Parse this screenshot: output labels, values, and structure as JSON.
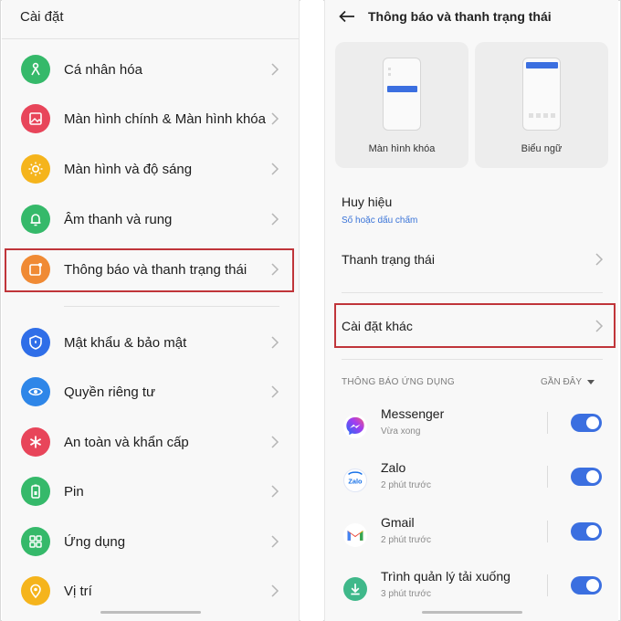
{
  "left": {
    "title": "Cài đặt",
    "items": [
      {
        "label": "Cá nhân hóa",
        "icon": "personalization-icon",
        "color": "#35b96a"
      },
      {
        "label": "Màn hình chính & Màn hình khóa",
        "icon": "wallpaper-icon",
        "color": "#e8455a"
      },
      {
        "label": "Màn hình và độ sáng",
        "icon": "brightness-icon",
        "color": "#f5b41c"
      },
      {
        "label": "Âm thanh và rung",
        "icon": "bell-icon",
        "color": "#35b96a"
      },
      {
        "label": "Thông báo và thanh trạng thái",
        "icon": "notification-icon",
        "color": "#f08a34"
      },
      {
        "label": "Mật khẩu & bảo mật",
        "icon": "shield-icon",
        "color": "#2f6ee8"
      },
      {
        "label": "Quyền riêng tư",
        "icon": "eye-icon",
        "color": "#2e86e8"
      },
      {
        "label": "An toàn và khẩn cấp",
        "icon": "emergency-icon",
        "color": "#e8455a"
      },
      {
        "label": "Pin",
        "icon": "battery-icon",
        "color": "#35b96a"
      },
      {
        "label": "Ứng dụng",
        "icon": "apps-icon",
        "color": "#35b96a"
      },
      {
        "label": "Vị trí",
        "icon": "location-icon",
        "color": "#f5b41c"
      }
    ]
  },
  "right": {
    "title": "Thông báo và thanh trạng thái",
    "cards": [
      {
        "label": "Màn hình khóa"
      },
      {
        "label": "Biểu ngữ"
      }
    ],
    "badge": {
      "title": "Huy hiệu",
      "subtitle": "Số hoặc dấu chấm"
    },
    "status_bar": "Thanh trạng thái",
    "other_settings": "Cài đặt khác",
    "section_title": "THÔNG BÁO ỨNG DỤNG",
    "sort_label": "GẦN ĐÂY",
    "apps": [
      {
        "name": "Messenger",
        "time": "Vừa xong",
        "icon": "messenger-icon",
        "enabled": true
      },
      {
        "name": "Zalo",
        "time": "2 phút trước",
        "icon": "zalo-icon",
        "enabled": true
      },
      {
        "name": "Gmail",
        "time": "2 phút trước",
        "icon": "gmail-icon",
        "enabled": true
      },
      {
        "name": "Trình quản lý tải xuống",
        "time": "3 phút trước",
        "icon": "download-manager-icon",
        "enabled": true
      }
    ]
  },
  "colors": {
    "highlight": "#c0353a",
    "accent": "#3b6fe0",
    "link": "#3a74d8"
  }
}
